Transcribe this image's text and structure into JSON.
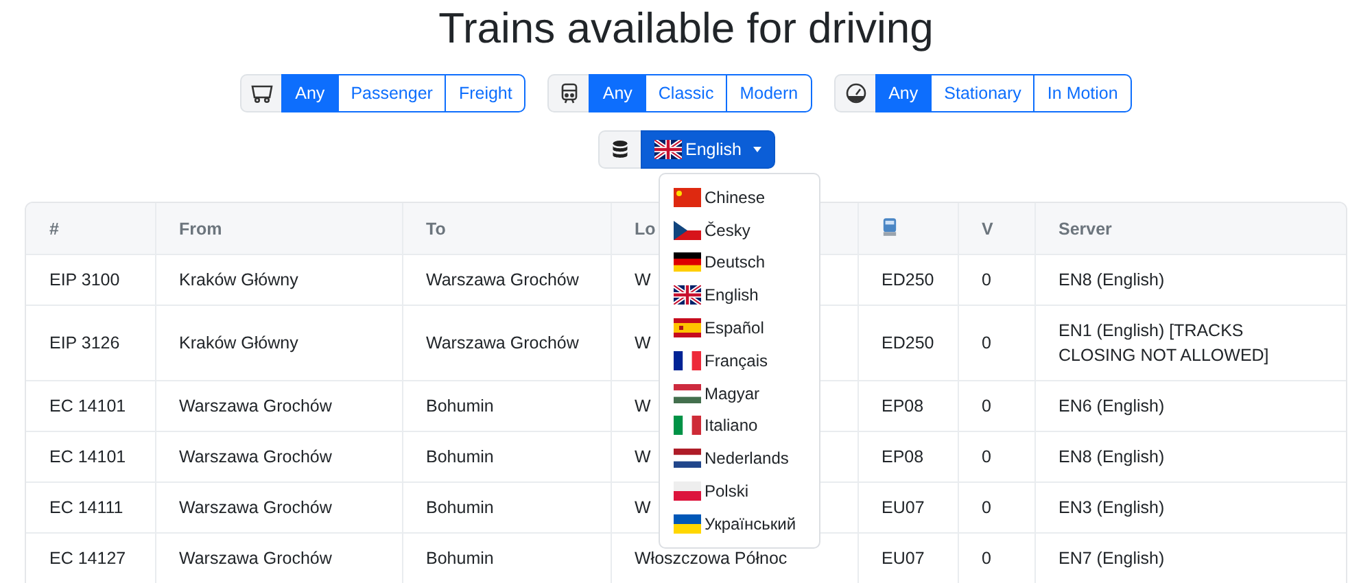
{
  "title": "Trains available for driving",
  "filters": [
    {
      "kind": "wagon",
      "options": [
        {
          "label": "Any",
          "selected": true
        },
        {
          "label": "Passenger",
          "selected": false
        },
        {
          "label": "Freight",
          "selected": false
        }
      ]
    },
    {
      "kind": "train",
      "options": [
        {
          "label": "Any",
          "selected": true
        },
        {
          "label": "Classic",
          "selected": false
        },
        {
          "label": "Modern",
          "selected": false
        }
      ]
    },
    {
      "kind": "gauge",
      "options": [
        {
          "label": "Any",
          "selected": true
        },
        {
          "label": "Stationary",
          "selected": false
        },
        {
          "label": "In Motion",
          "selected": false
        }
      ]
    }
  ],
  "language": {
    "kind": "database",
    "button": {
      "kind": "gb",
      "label": "English"
    },
    "expanded": true,
    "menu": [
      {
        "kind": "cn",
        "label": "Chinese"
      },
      {
        "kind": "cz",
        "label": "Česky"
      },
      {
        "kind": "de",
        "label": "Deutsch"
      },
      {
        "kind": "gb",
        "label": "English"
      },
      {
        "kind": "es",
        "label": "Español"
      },
      {
        "kind": "fr",
        "label": "Français"
      },
      {
        "kind": "hu",
        "label": "Magyar"
      },
      {
        "kind": "it",
        "label": "Italiano"
      },
      {
        "kind": "nl",
        "label": "Nederlands"
      },
      {
        "kind": "pl",
        "label": "Polski"
      },
      {
        "kind": "ua",
        "label": "Український"
      }
    ]
  },
  "table": {
    "columns": [
      {
        "kind": "text",
        "label": "#"
      },
      {
        "kind": "text",
        "label": "From"
      },
      {
        "kind": "text",
        "label": "To"
      },
      {
        "kind": "text",
        "label": "Lo"
      },
      {
        "kind": "train-icon"
      },
      {
        "kind": "text",
        "label": "V"
      },
      {
        "kind": "text",
        "label": "Server"
      }
    ],
    "rows": [
      [
        "EIP 3100",
        "Kraków Główny",
        "Warszawa Grochów",
        "W",
        "ED250",
        "0",
        "EN8 (English)"
      ],
      [
        "EIP 3126",
        "Kraków Główny",
        "Warszawa Grochów",
        "W",
        "ED250",
        "0",
        "EN1 (English) [TRACKS CLOSING NOT ALLOWED]"
      ],
      [
        "EC 14101",
        "Warszawa Grochów",
        "Bohumin",
        "W",
        "EP08",
        "0",
        "EN6 (English)"
      ],
      [
        "EC 14101",
        "Warszawa Grochów",
        "Bohumin",
        "W",
        "EP08",
        "0",
        "EN8 (English)"
      ],
      [
        "EC 14111",
        "Warszawa Grochów",
        "Bohumin",
        "W",
        "EU07",
        "0",
        "EN3 (English)"
      ],
      [
        "EC 14127",
        "Warszawa Grochów",
        "Bohumin",
        "Włoszczowa Północ",
        "EU07",
        "0",
        "EN7 (English)"
      ]
    ]
  }
}
